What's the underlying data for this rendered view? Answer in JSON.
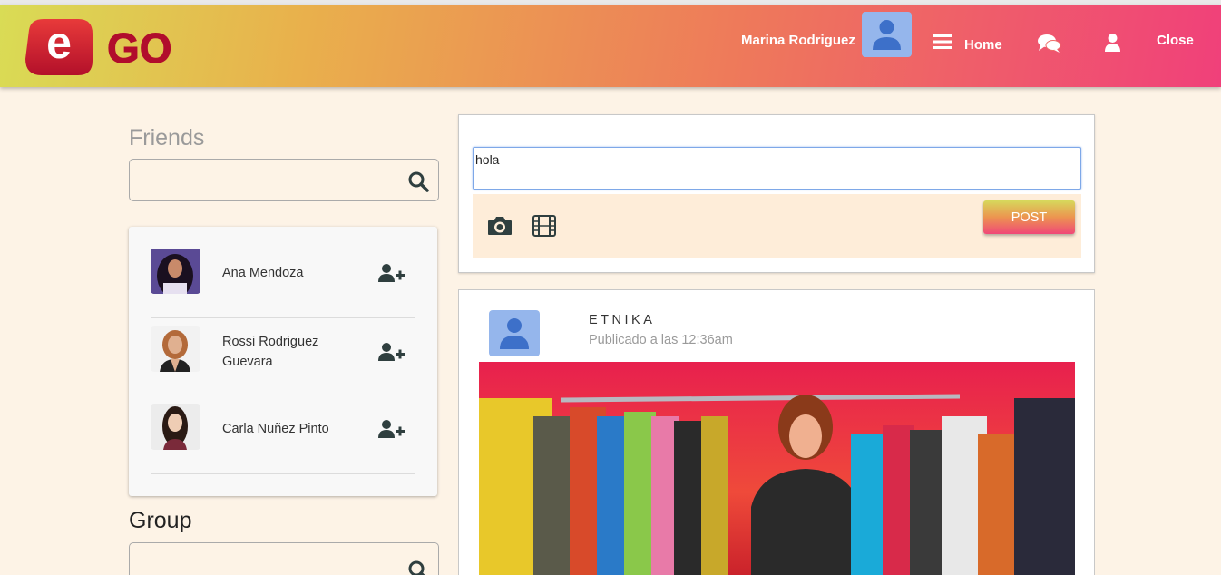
{
  "brand": {
    "logo_letter": "e",
    "logo_text": "GO",
    "accent": "#c8102e"
  },
  "nav": {
    "user_name": "Marina Rodriguez",
    "home_label": "Home",
    "close_label": "Close",
    "icons": [
      "menu-icon",
      "chat-icon",
      "user-icon"
    ]
  },
  "sidebar": {
    "friends_title": "Friends",
    "friends_search": {
      "value": "",
      "icon": "search-icon"
    },
    "friends": [
      {
        "name": "Ana Mendoza"
      },
      {
        "name": "Rossi Rodriguez Guevara"
      },
      {
        "name": "Carla Nuñez Pinto"
      }
    ],
    "group_title": "Group",
    "group_search": {
      "value": "",
      "icon": "search-icon"
    }
  },
  "composer": {
    "text": "hola",
    "post_label": "POST",
    "icons": [
      "camera-icon",
      "film-icon"
    ]
  },
  "post": {
    "author": "ETNIKA",
    "time": "Publicado a las 12:36am"
  },
  "colors": {
    "background": "#fdf3e6",
    "composer_bar": "#feedd9",
    "avatar_blue": "#95b6ec",
    "avatar_dark": "#3d70c9",
    "icon_dark": "#2f3f3f"
  }
}
